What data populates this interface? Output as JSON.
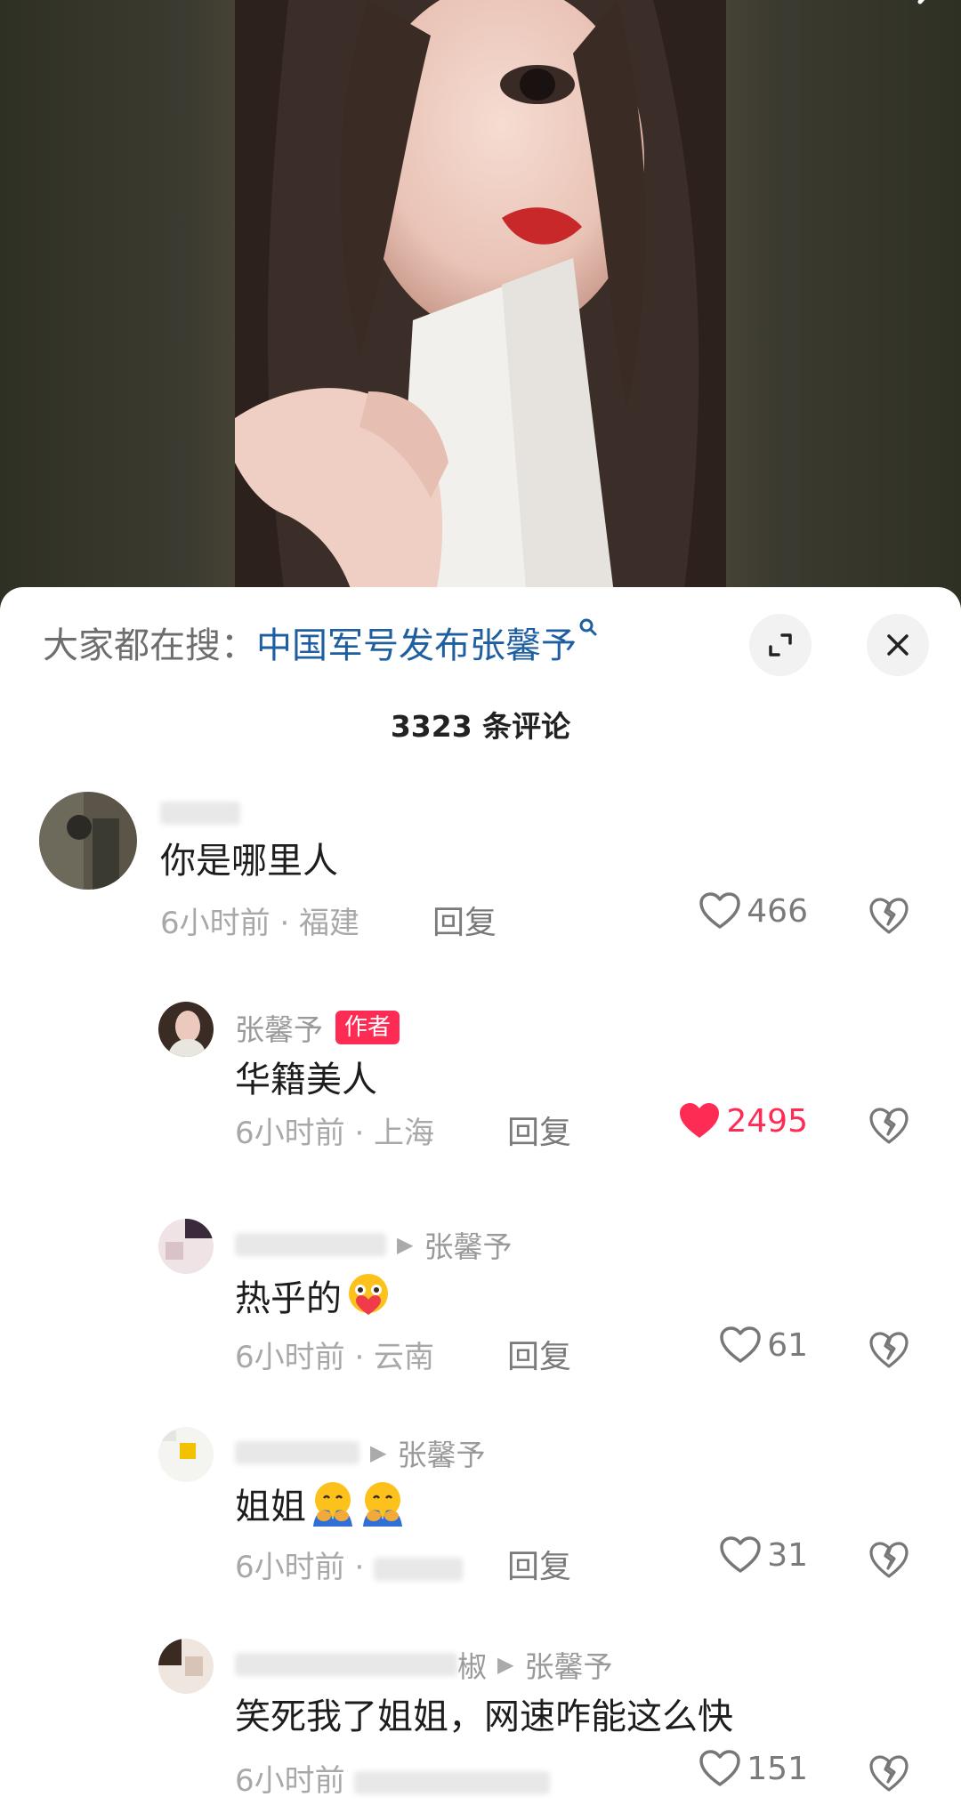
{
  "search_hint": {
    "label": "大家都在搜：",
    "term": "中国军号发布张馨予"
  },
  "comment_count": "3323 条评论",
  "comments": [
    {
      "user": "",
      "text": "你是哪里人",
      "time_location": "6小时前 · 福建",
      "reply": "回复",
      "likes": "466",
      "liked": false
    },
    {
      "user": "张馨予",
      "badge": "作者",
      "text": "华籍美人",
      "time_location": "6小时前 · 上海",
      "reply": "回复",
      "likes": "2495",
      "liked": true
    },
    {
      "user": "",
      "reply_to": "张馨予",
      "text": "热乎的",
      "emoji": "hug-face-heart-emoji",
      "time_location": "6小时前 · 云南",
      "reply": "回复",
      "likes": "61",
      "liked": false
    },
    {
      "user": "",
      "reply_to": "张馨予",
      "text": "姐姐",
      "emoji": "hugging-face-emoji",
      "time_location": "6小时前 ·",
      "reply": "回复",
      "likes": "31",
      "liked": false
    },
    {
      "user": "椒",
      "reply_to": "张馨予",
      "text": "笑死我了姐姐，网速咋能这么快",
      "time_location": "6小时前",
      "reply": "",
      "likes": "151",
      "liked": false
    }
  ],
  "colors": {
    "link_blue": "#1f5fa0",
    "like_red": "#fe2c55",
    "badge_red": "#fe2c55"
  }
}
